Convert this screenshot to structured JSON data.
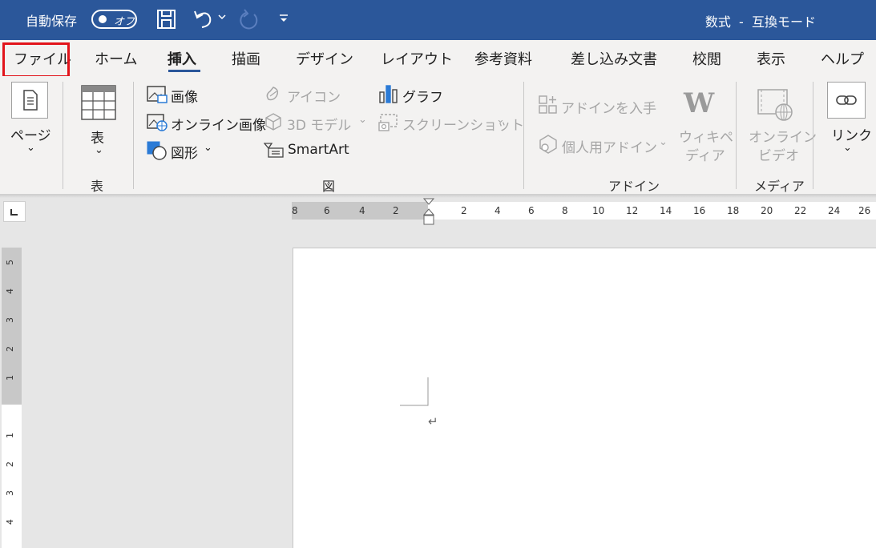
{
  "titlebar": {
    "autosave_label": "自動保存",
    "toggle_label": "オフ",
    "document_title": "数式  -  互換モード",
    "accent_color": "#2b579a"
  },
  "tabs": [
    {
      "label": "ファイル"
    },
    {
      "label": "ホーム"
    },
    {
      "label": "挿入"
    },
    {
      "label": "描画"
    },
    {
      "label": "デザイン"
    },
    {
      "label": "レイアウト"
    },
    {
      "label": "参考資料"
    },
    {
      "label": "差し込み文書"
    },
    {
      "label": "校閲"
    },
    {
      "label": "表示"
    },
    {
      "label": "ヘルプ"
    }
  ],
  "ribbon": {
    "page_label": "ページ",
    "table_label": "表",
    "table_group": "表",
    "image_label": "画像",
    "online_image_label": "オンライン画像",
    "shapes_label": "図形",
    "icons_label": "アイコン",
    "model_3d_label": "3D モデル",
    "smartart_label": "SmartArt",
    "chart_label": "グラフ",
    "screenshot_label": "スクリーンショット",
    "figure_group": "図",
    "get_addins_label": "アドインを入手",
    "my_addins_label": "個人用アドイン",
    "wiki_label_1": "ウィキペ",
    "wiki_label_2": "ディア",
    "addin_group": "アドイン",
    "online_video_1": "オンライン",
    "online_video_2": "ビデオ",
    "media_group": "メディア",
    "link_label": "リンク"
  },
  "ruler": {
    "horizontal_ticks": [
      "8",
      "6",
      "4",
      "2",
      "2",
      "4",
      "6",
      "8",
      "10",
      "12",
      "14",
      "16",
      "18",
      "20",
      "22",
      "24",
      "26"
    ],
    "vertical_ticks": [
      "5",
      "4",
      "3",
      "2",
      "1",
      "1",
      "2",
      "3",
      "4"
    ]
  },
  "document": {
    "paragraph_mark": "↵"
  }
}
